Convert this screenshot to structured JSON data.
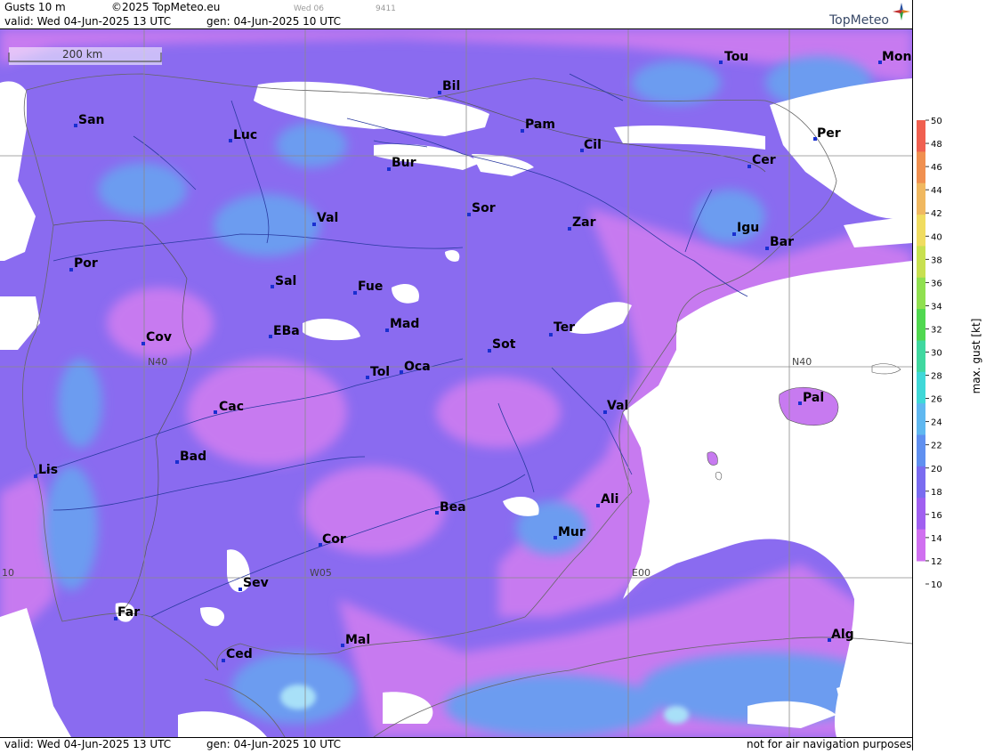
{
  "header": {
    "title": "Gusts 10 m",
    "copyright": "©2025 TopMeteo.eu",
    "valid": "valid:  Wed  04-Jun-2025  13 UTC",
    "gen": "gen: 04-Jun-2025 10 UTC",
    "faint_day": "Wed 06",
    "faint_code": "9411",
    "brand": "TopMeteo"
  },
  "footer": {
    "valid": "valid:  Wed  04-Jun-2025  13 UTC",
    "gen": "gen: 04-Jun-2025 10 UTC",
    "note": "not for air navigation purposes"
  },
  "scale_bar": {
    "label": "200 km"
  },
  "grid_labels": {
    "lat": "N40",
    "lat_right": "N40",
    "lon_w05": "W05",
    "lon_e00": "E00",
    "lon_w10": "10"
  },
  "cities": [
    "Tou",
    "Mon",
    "Bil",
    "San",
    "Pam",
    "Luc",
    "Cil",
    "Per",
    "Bur",
    "Cer",
    "Sor",
    "Val",
    "Zar",
    "Igu",
    "Bar",
    "Por",
    "Sal",
    "Fue",
    "Mad",
    "Ter",
    "Cov",
    "EBa",
    "Sot",
    "Tol",
    "Oca",
    "Pal",
    "Val",
    "Cac",
    "Bad",
    "Lis",
    "Ali",
    "Bea",
    "Mur",
    "Cor",
    "Sev",
    "Far",
    "Alg",
    "Mal",
    "Ced"
  ],
  "legend": {
    "title": "max. gust  [kt]",
    "ticks": [
      "50",
      "48",
      "46",
      "44",
      "42",
      "40",
      "38",
      "36",
      "34",
      "32",
      "30",
      "28",
      "26",
      "24",
      "22",
      "20",
      "18",
      "16",
      "14",
      "12",
      "10"
    ],
    "colors": [
      "#f06050",
      "#f09050",
      "#f0b860",
      "#f0dc60",
      "#c8e050",
      "#90e050",
      "#50d850",
      "#40d8a0",
      "#40d8d8",
      "#60b8f0",
      "#6090f0",
      "#7a6cf0",
      "#a060f0",
      "#d070f0"
    ]
  },
  "colors": {
    "land_base": "#8a6bf0",
    "gust_light": "#c77af0",
    "gust_blue": "#6c9cf0",
    "sea_white": "#ffffff"
  }
}
